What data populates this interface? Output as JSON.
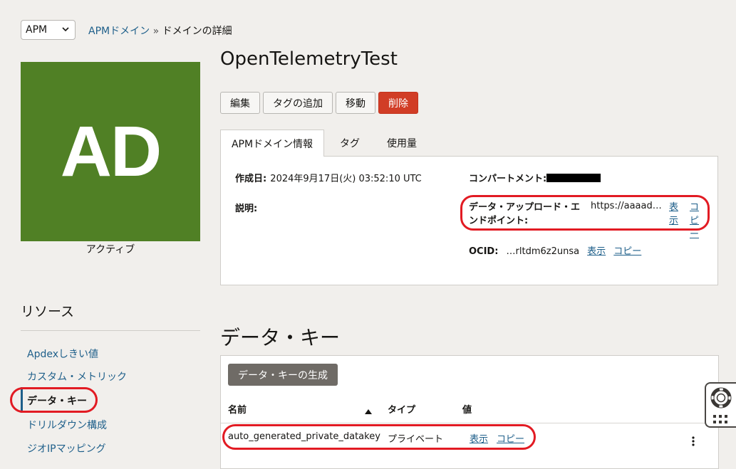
{
  "region": {
    "selected": "APM"
  },
  "breadcrumb": {
    "parent": "APMドメイン",
    "separator": "»",
    "current": "ドメインの詳細"
  },
  "avatar": {
    "initials": "AD",
    "color": "#508025"
  },
  "status": "アクティブ",
  "title": "OpenTelemetryTest",
  "actions": {
    "edit": "編集",
    "add_tag": "タグの追加",
    "move": "移動",
    "delete": "削除"
  },
  "tabs": [
    "APMドメイン情報",
    "タグ",
    "使用量"
  ],
  "info": {
    "created_label": "作成日:",
    "created_value": "2024年9月17日(火) 03:52:10 UTC",
    "description_label": "説明:",
    "compartment_label": "コンパートメント:",
    "endpoint_label_line1": "データ・アップロード・エ",
    "endpoint_label_line2": "ンドポイント:",
    "endpoint_value": "https://aaaad…",
    "show": "表示",
    "copy": "コピー",
    "ocid_label": "OCID:",
    "ocid_value": "…rltdm6z2unsa"
  },
  "resources": {
    "title": "リソース",
    "items": [
      "Apdexしきい値",
      "カスタム・メトリック",
      "データ・キー",
      "ドリルダウン構成",
      "ジオIPマッピング"
    ]
  },
  "data_keys": {
    "title": "データ・キー",
    "generate_button": "データ・キーの生成",
    "columns": {
      "name": "名前",
      "type": "タイプ",
      "value": "値"
    },
    "rows": [
      {
        "name": "auto_generated_private_datakey",
        "type": "プライベート",
        "show": "表示",
        "copy": "コピー"
      }
    ]
  },
  "colors": {
    "accent": "#1e5f8a",
    "danger": "#d13d26",
    "highlight": "#e21b23"
  }
}
